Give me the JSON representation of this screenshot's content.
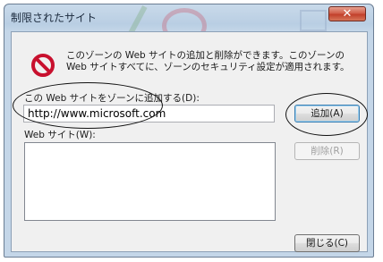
{
  "window": {
    "title": "制限されたサイト",
    "close_label": "✕"
  },
  "dialog": {
    "description": "このゾーンの Web サイトの追加と削除ができます。このゾーンの Web サイトすべてに、ゾーンのセキュリティ設定が適用されます。",
    "add_label": "この Web サイトをゾーンに追加する(D):",
    "url_value": "http://www.microsoft.com",
    "add_button": "追加(A)",
    "sites_label": "Web サイト(W):",
    "sites": [],
    "remove_button": "削除(R)",
    "close_button": "閉じる(C)"
  },
  "icons": {
    "warning": "no-entry-icon"
  },
  "colors": {
    "icon_red": "#c8102e",
    "title_bar": "#c4d6e8",
    "close_red": "#c2412b"
  }
}
